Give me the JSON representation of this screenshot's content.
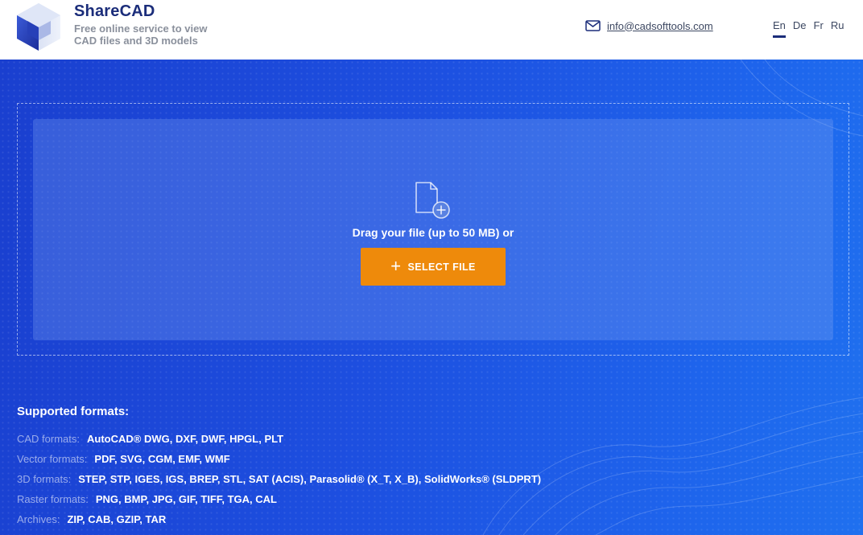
{
  "header": {
    "brand": "ShareCAD",
    "tagline_line1": "Free online service to view",
    "tagline_line2": "CAD files and 3D models",
    "email": "info@cadsofttools.com",
    "languages": [
      "En",
      "De",
      "Fr",
      "Ru"
    ],
    "active_language": "En"
  },
  "upload": {
    "drag_text": "Drag your file (up to 50 MB) or",
    "select_button": "SELECT FILE"
  },
  "formats": {
    "title": "Supported formats:",
    "rows": [
      {
        "label": "CAD formats:",
        "value": "AutoCAD® DWG, DXF, DWF, HPGL, PLT"
      },
      {
        "label": "Vector formats:",
        "value": "PDF, SVG, CGM, EMF, WMF"
      },
      {
        "label": "3D formats:",
        "value": "STEP, STP, IGES, IGS, BREP, STL, SAT (ACIS), Parasolid® (X_T, X_B), SolidWorks® (SLDPRT)"
      },
      {
        "label": "Raster formats:",
        "value": "PNG, BMP, JPG, GIF, TIFF, TGA, CAL"
      },
      {
        "label": "Archives:",
        "value": "ZIP, CAB, GZIP, TAR"
      }
    ]
  },
  "colors": {
    "brand_navy": "#1b2d7a",
    "accent_orange": "#ee8a0b",
    "background_blue": "#1d4fe0"
  },
  "icons": {
    "logo": "cube-logo-icon",
    "email": "mail-icon",
    "upload": "file-add-icon",
    "button": "plus-icon"
  }
}
